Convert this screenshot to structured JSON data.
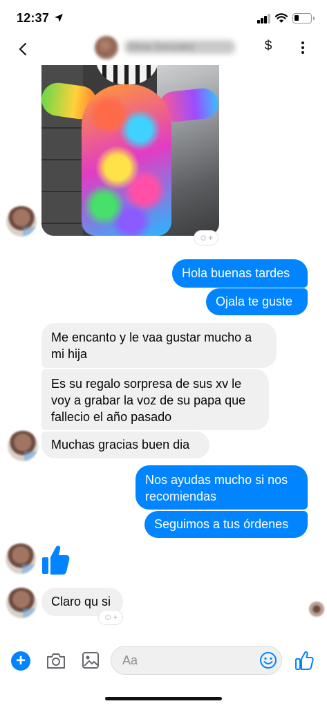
{
  "status_bar": {
    "time": "12:37"
  },
  "header": {
    "contact_name": "Silvia Gonzalez",
    "dollar_label": "$"
  },
  "messages": [
    {
      "dir": "out",
      "text": "Hola buenas tardes"
    },
    {
      "dir": "out",
      "text": "Ojala te guste"
    },
    {
      "dir": "in",
      "lines": [
        "Me encanto y le vaa gustar mucho a",
        "mi hija"
      ]
    },
    {
      "dir": "in",
      "lines": [
        "Es su regalo sorpresa de sus xv le",
        "voy a grabar la voz de su papa que",
        "fallecio el año pasado"
      ]
    },
    {
      "dir": "in",
      "text": "Muchas gracias buen dia"
    },
    {
      "dir": "out",
      "lines": [
        "Nos ayudas mucho si nos",
        "recomiendas"
      ]
    },
    {
      "dir": "out",
      "text": "Seguimos a tus órdenes"
    },
    {
      "dir": "in",
      "text": "Claro qu si"
    }
  ],
  "reaction_add_symbol": "☺+",
  "composer": {
    "placeholder": "Aa",
    "add_symbol": "+"
  },
  "colors": {
    "outgoing_bubble": "#0084ff",
    "incoming_bubble": "#f0f0f0",
    "accent": "#0084ff"
  },
  "icons": [
    "location-arrow-icon",
    "signal-icon",
    "wifi-icon",
    "battery-icon",
    "back-chevron-icon",
    "more-icon",
    "camera-icon",
    "gallery-icon",
    "emoji-icon",
    "thumbs-up-icon"
  ]
}
